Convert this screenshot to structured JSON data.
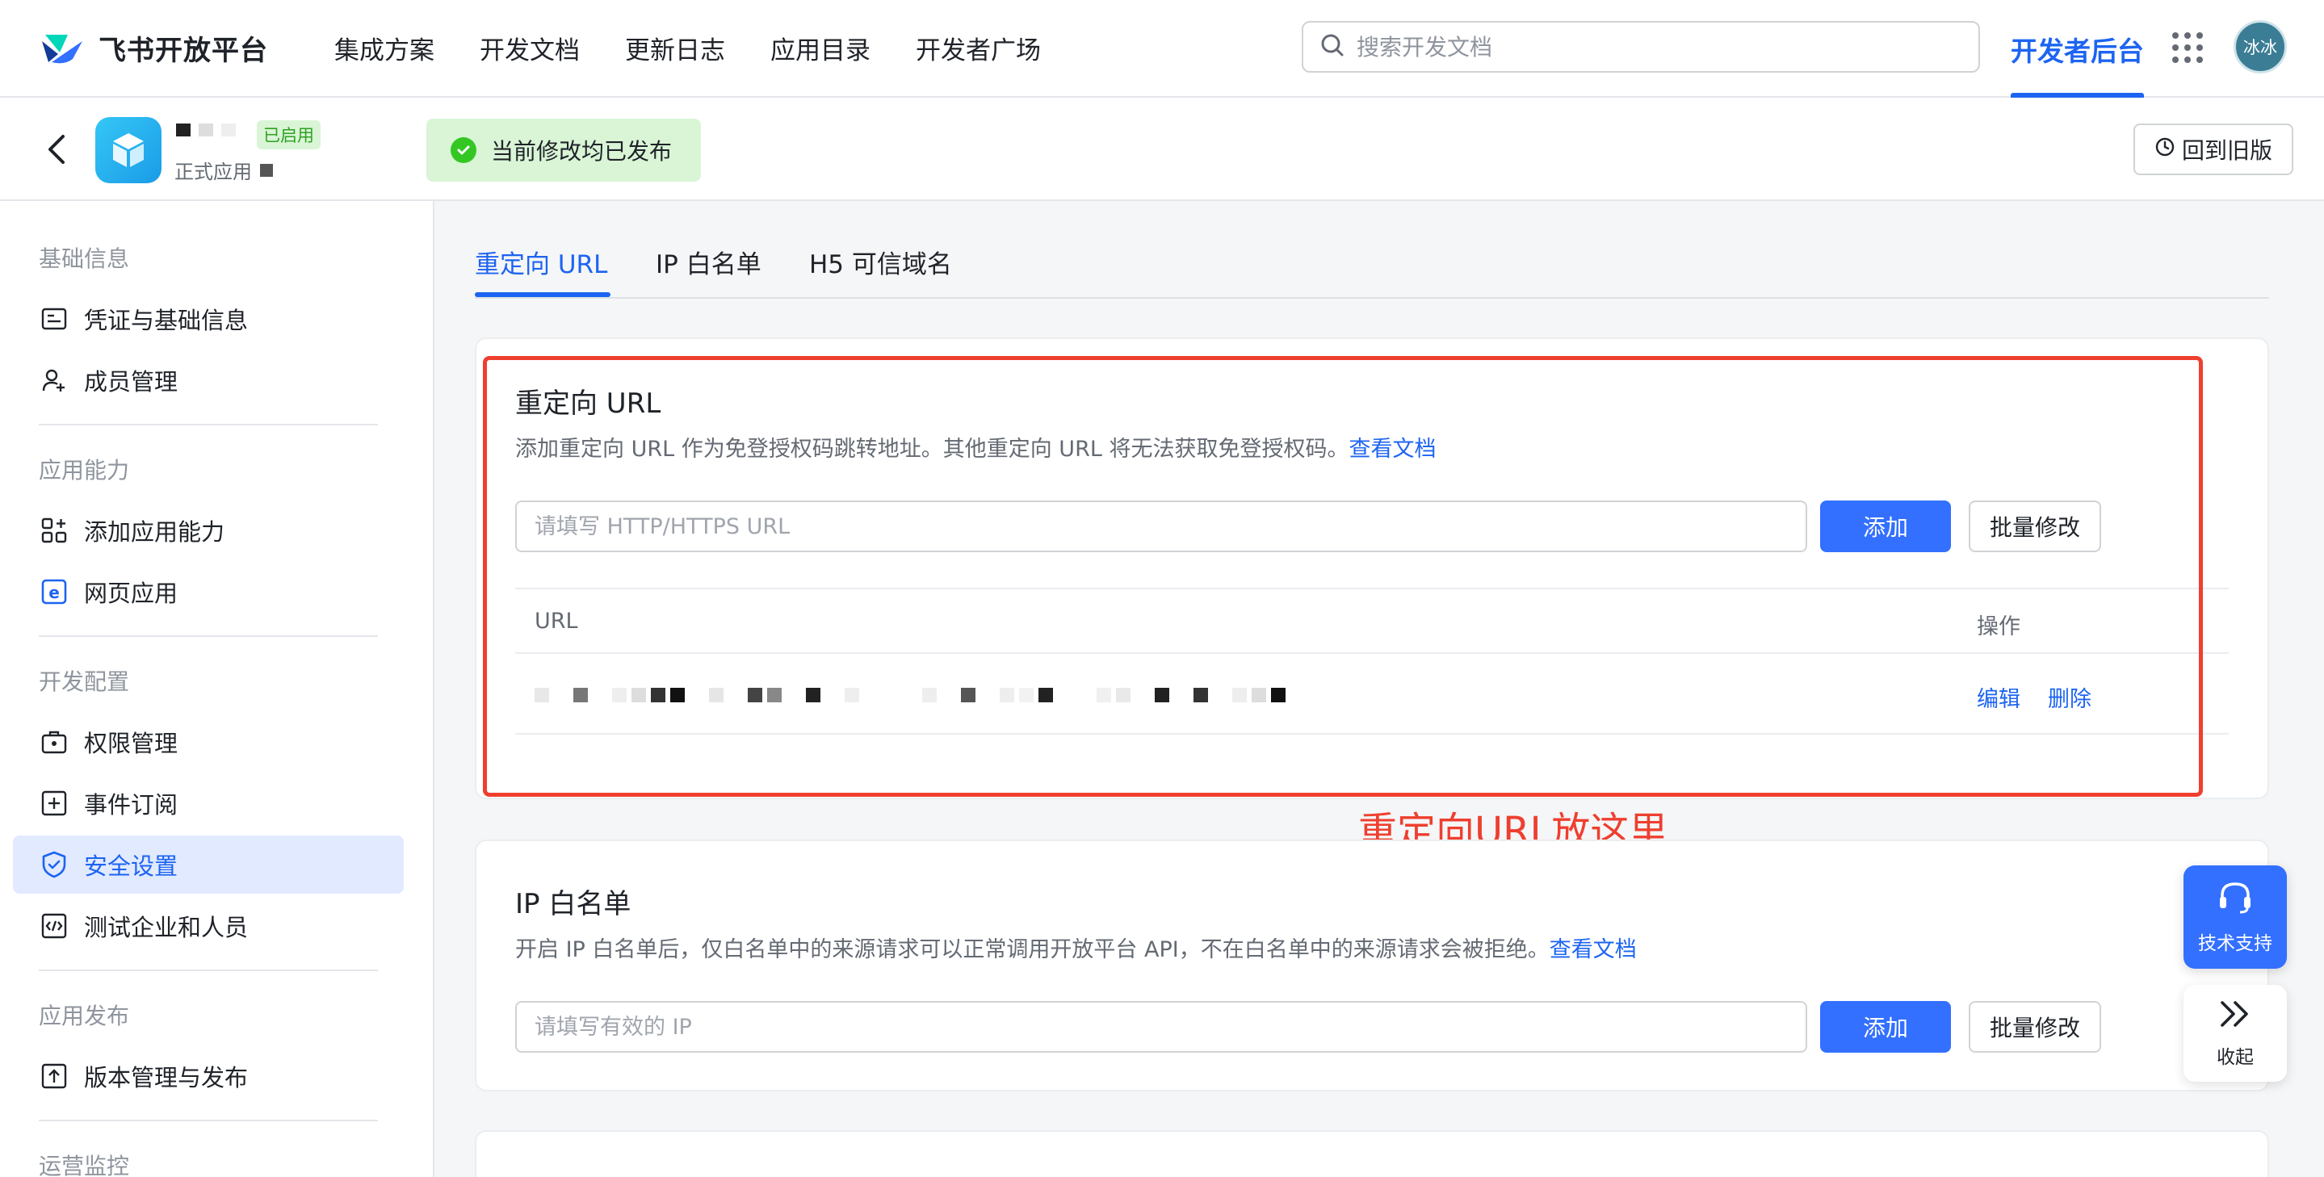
{
  "topnav": {
    "brand": "飞书开放平台",
    "items": [
      "集成方案",
      "开发文档",
      "更新日志",
      "应用目录",
      "开发者广场"
    ],
    "search_placeholder": "搜索开发文档",
    "dev_console": "开发者后台",
    "avatar_text": "冰冰"
  },
  "app_header": {
    "status_tag": "已启用",
    "app_type": "正式应用",
    "publish_status": "当前修改均已发布",
    "revert_label": "回到旧版"
  },
  "sidebar": {
    "groups": {
      "basic": "基础信息",
      "capability": "应用能力",
      "dev_config": "开发配置",
      "release": "应用发布",
      "ops": "运营监控"
    },
    "items": {
      "credentials": "凭证与基础信息",
      "members": "成员管理",
      "add_capability": "添加应用能力",
      "web_app": "网页应用",
      "permissions": "权限管理",
      "events": "事件订阅",
      "security": "安全设置",
      "test_enterprise": "测试企业和人员",
      "version": "版本管理与发布"
    }
  },
  "tabs": [
    "重定向 URL",
    "IP 白名单",
    "H5 可信域名"
  ],
  "redirect": {
    "title": "重定向 URL",
    "desc": "添加重定向 URL 作为免登授权码跳转地址。其他重定向 URL 将无法获取免登授权码。",
    "doc_link": "查看文档",
    "placeholder": "请填写 HTTP/HTTPS URL",
    "add_label": "添加",
    "batch_label": "批量修改",
    "col_url": "URL",
    "col_action": "操作",
    "edit_label": "编辑",
    "delete_label": "删除"
  },
  "annotation": "重定向URL放这里",
  "ip_whitelist": {
    "title": "IP 白名单",
    "desc": "开启 IP 白名单后，仅白名单中的来源请求可以正常调用开放平台 API，不在白名单中的来源请求会被拒绝。",
    "doc_link": "查看文档",
    "placeholder": "请填写有效的 IP",
    "add_label": "添加",
    "batch_label": "批量修改"
  },
  "floating": {
    "support": "技术支持",
    "collapse": "收起"
  },
  "colors": {
    "primary": "#3370ff",
    "link": "#1d64f2",
    "annotation": "#ee3f2f",
    "success_bg": "#d9f5d6"
  }
}
